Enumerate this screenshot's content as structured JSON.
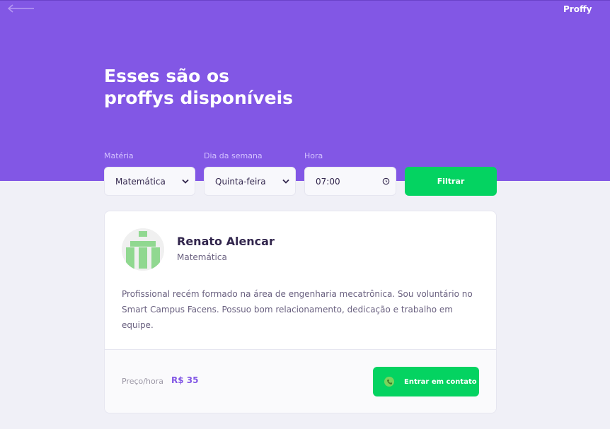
{
  "header": {
    "logo": "Proffy",
    "title_line1": "Esses são os",
    "title_line2": "proffys disponíveis"
  },
  "filters": {
    "subject_label": "Matéria",
    "subject_value": "Matemática",
    "weekday_label": "Dia da semana",
    "weekday_value": "Quinta-feira",
    "time_label": "Hora",
    "time_value": "07:00",
    "submit_label": "Filtrar"
  },
  "teacher": {
    "name": "Renato Alencar",
    "subject": "Matemática",
    "bio": "Profissional recém formado na área de engenharia mecatrônica. Sou voluntário no Smart Campus Facens. Possuo bom relacionamento, dedicação e trabalho em equipe.",
    "price_label": "Preço/hora",
    "price_value": "R$ 35",
    "contact_label": "Entrar em contato"
  },
  "colors": {
    "primary": "#8257e5",
    "secondary": "#04d361",
    "background": "#f0f0f7"
  },
  "icons": {
    "back": "back-arrow-icon",
    "select": "chevron-down-icon",
    "time": "clock-icon",
    "contact": "whatsapp-icon"
  }
}
